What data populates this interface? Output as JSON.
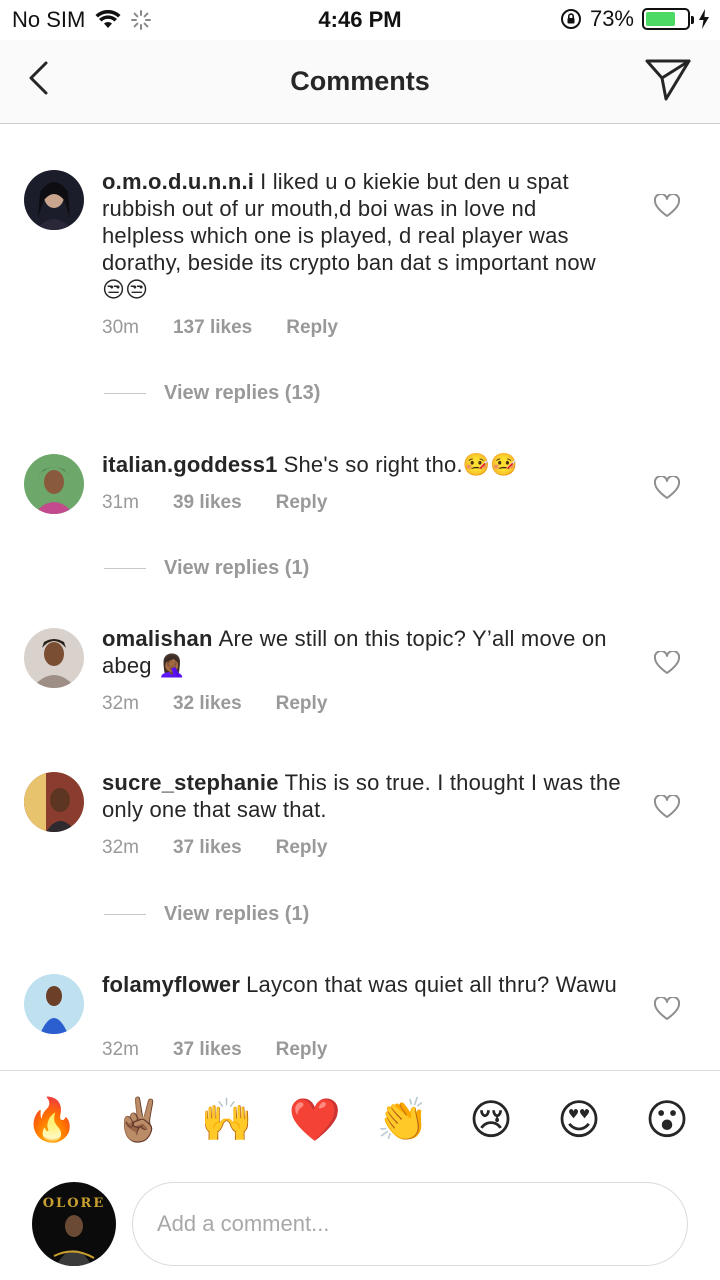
{
  "status_bar": {
    "carrier": "No SIM",
    "time": "4:46 PM",
    "battery": "73%",
    "battery_fraction": 0.73
  },
  "header": {
    "title": "Comments",
    "back_icon": "chevron-left-icon",
    "send_icon": "paper-plane-icon"
  },
  "comments": [
    {
      "username": "o.m.o.d.u.n.n.i",
      "text": "I liked u o kiekie but den u spat rubbish out of ur mouth,d boi was in love nd helpless which one is played, d real player was dorathy, beside its crypto ban dat s important now 😒😒",
      "time": "30m",
      "likes": "137 likes",
      "reply": "Reply",
      "view_replies": "View replies (13)"
    },
    {
      "username": "italian.goddess1",
      "text": "She's so right tho.🤒🤒",
      "time": "31m",
      "likes": "39 likes",
      "reply": "Reply",
      "view_replies": "View replies (1)"
    },
    {
      "username": "omalishan",
      "text": "Are we still on this topic? Y’all move on abeg 🤦🏾‍♀️",
      "time": "32m",
      "likes": "32 likes",
      "reply": "Reply",
      "view_replies": ""
    },
    {
      "username": "sucre_stephanie",
      "text": "This is so true. I thought I was the only one that saw that.",
      "time": "32m",
      "likes": "37 likes",
      "reply": "Reply",
      "view_replies": "View replies (1)"
    },
    {
      "username": "folamyflower",
      "text": "Laycon that was quiet all thru? Wawu",
      "time": "32m",
      "likes": "37 likes",
      "reply": "Reply",
      "view_replies": ""
    }
  ],
  "emoji_bar": [
    "🔥",
    "✌🏽",
    "🙌",
    "❤️",
    "👏",
    "😢",
    "😍",
    "😮"
  ],
  "composer": {
    "placeholder": "Add a comment...",
    "avatar_brand": "OLORE"
  }
}
